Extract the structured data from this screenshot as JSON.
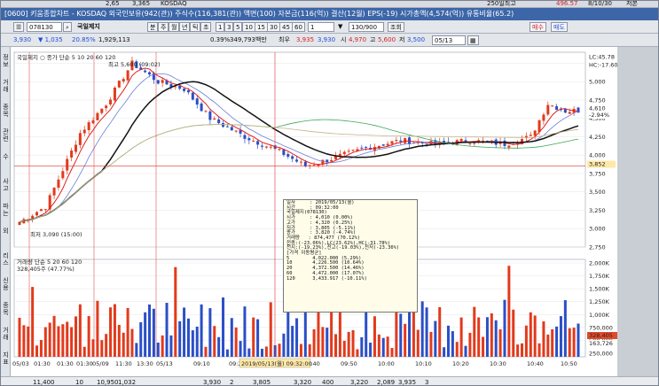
{
  "top_strip": {
    "values": [
      "2,65",
      "3,365",
      "KOSDAQ",
      "250일최고",
      "496.57",
      "8/10/30",
      "저본"
    ]
  },
  "titlebar": {
    "items": [
      "[0600] 키움종합차트 - KOSDAQ 외국인보유(942(관)) 주식수(116,381(관)) 액면(100) 자본금(116(억)) 결산(12월) EPS(-19) 시가총액(4,574(억)) 유통비율(65.2)"
    ]
  },
  "toolbar1": {
    "code": "078130",
    "name": "국일제지",
    "menu": [
      "분",
      "주",
      "월",
      "년",
      "틱",
      "초",
      "1",
      "3",
      "5",
      "10",
      "15",
      "30",
      "45",
      "60",
      "1"
    ],
    "range": "130/900",
    "btn_lookup": "조회",
    "extra": [
      "매수",
      "매도"
    ]
  },
  "toolbar2": {
    "price": "3,930",
    "change": "▼ 1,035",
    "rate": "20.85%",
    "volume": "1,929,113",
    "rate2": "0.39%",
    "amount": "349,793백만",
    "label_cur": "최우",
    "p1": "3,935",
    "p2": "3,930",
    "open_label": "시",
    "open": "4,970",
    "high_label": "고",
    "high": "5,600",
    "low_label": "저",
    "low": "3,500",
    "date": "05/13"
  },
  "left_vertical": [
    "정보",
    "거래",
    "종목",
    "관련",
    "수",
    "사고",
    "파는",
    "외",
    "리스",
    "신용",
    "종목",
    "거래",
    "지표"
  ],
  "chart_data": {
    "type": "candlestick",
    "title": "국일제지",
    "legend": "국일제지 ○ 종가 단순 5 10 20 60 120",
    "annotations": {
      "high": "최고 5,600 (09:02)",
      "low": "최저 3,090 (15:00)",
      "volume_label": "거래량 단순 5 20 60 120",
      "volume_value": "328,405주 (47.77%)"
    },
    "price_axis": [
      "5,250",
      "5,000",
      "4,750",
      "4,500",
      "4,250",
      "4,000",
      "3,750",
      "3,500",
      "3,250",
      "3,000",
      "2,750"
    ],
    "price_right_labels": [
      "LC:45.78",
      "HC:-17.60",
      "4,610",
      "-2.94%",
      "3,852"
    ],
    "volume_axis": [
      "2,000K",
      "1,750K",
      "1,500K",
      "1,250K",
      "1,000K",
      "750,000",
      "500,000",
      "250,000"
    ],
    "volume_right_labels": [
      "328,405",
      "163,726"
    ],
    "x_labels": [
      "05/03",
      "01:30",
      "01:30",
      "01:30",
      "05/09",
      "11:30",
      "13:30",
      "05/13",
      "09:10",
      "09:20",
      "09:30",
      "09:40",
      "09:50",
      "10:00",
      "10:10",
      "10:20",
      "10:30",
      "10:40",
      "10:50"
    ],
    "cursor_x_label": "2019/05/13(월) 09:32:00",
    "ylim": [
      2750,
      5400
    ]
  },
  "tooltip": [
    "일자     : 2019/05/13(월)",
    "시간     : 09:32:00",
    "국일제지(078130)",
    "시가     : 4,010 (0.00%)",
    "고가     : 4,320 (0.25%)",
    "저가     : 3,805 (-5.11%)",
    "종가     : 3,820 (-4.74%)",
    "거래량   : 874,477 (70.12%)",
    "전종:(-23.06%),LC(23.62%),HC(-31.78%)",
    "전시:(-19.23%),전고(-19.03%),전저(-23.36%)",
    "[가격 이동평균]",
    "5        4,022.000 (5.29%)",
    "10       4,226.500 (10.64%)",
    "20       4,372.500 (14.46%)",
    "60       4,472.000 (17.07%)",
    "120      3,433.917 (-10.11%)"
  ],
  "bottom_strip": {
    "values": [
      "11,400",
      "10",
      "10,950",
      "1,032",
      "3,930",
      "2",
      "3,805",
      "3,320",
      "400",
      "3,220",
      "2,089",
      "3,935",
      "3"
    ]
  },
  "colors": {
    "up": "#e23a1c",
    "down": "#2a4fc7",
    "ma5": "#e02020",
    "ma10": "#6a7fd6",
    "ma20": "#111111",
    "ma60": "#3aa65a",
    "ma120": "#c8b38a"
  }
}
